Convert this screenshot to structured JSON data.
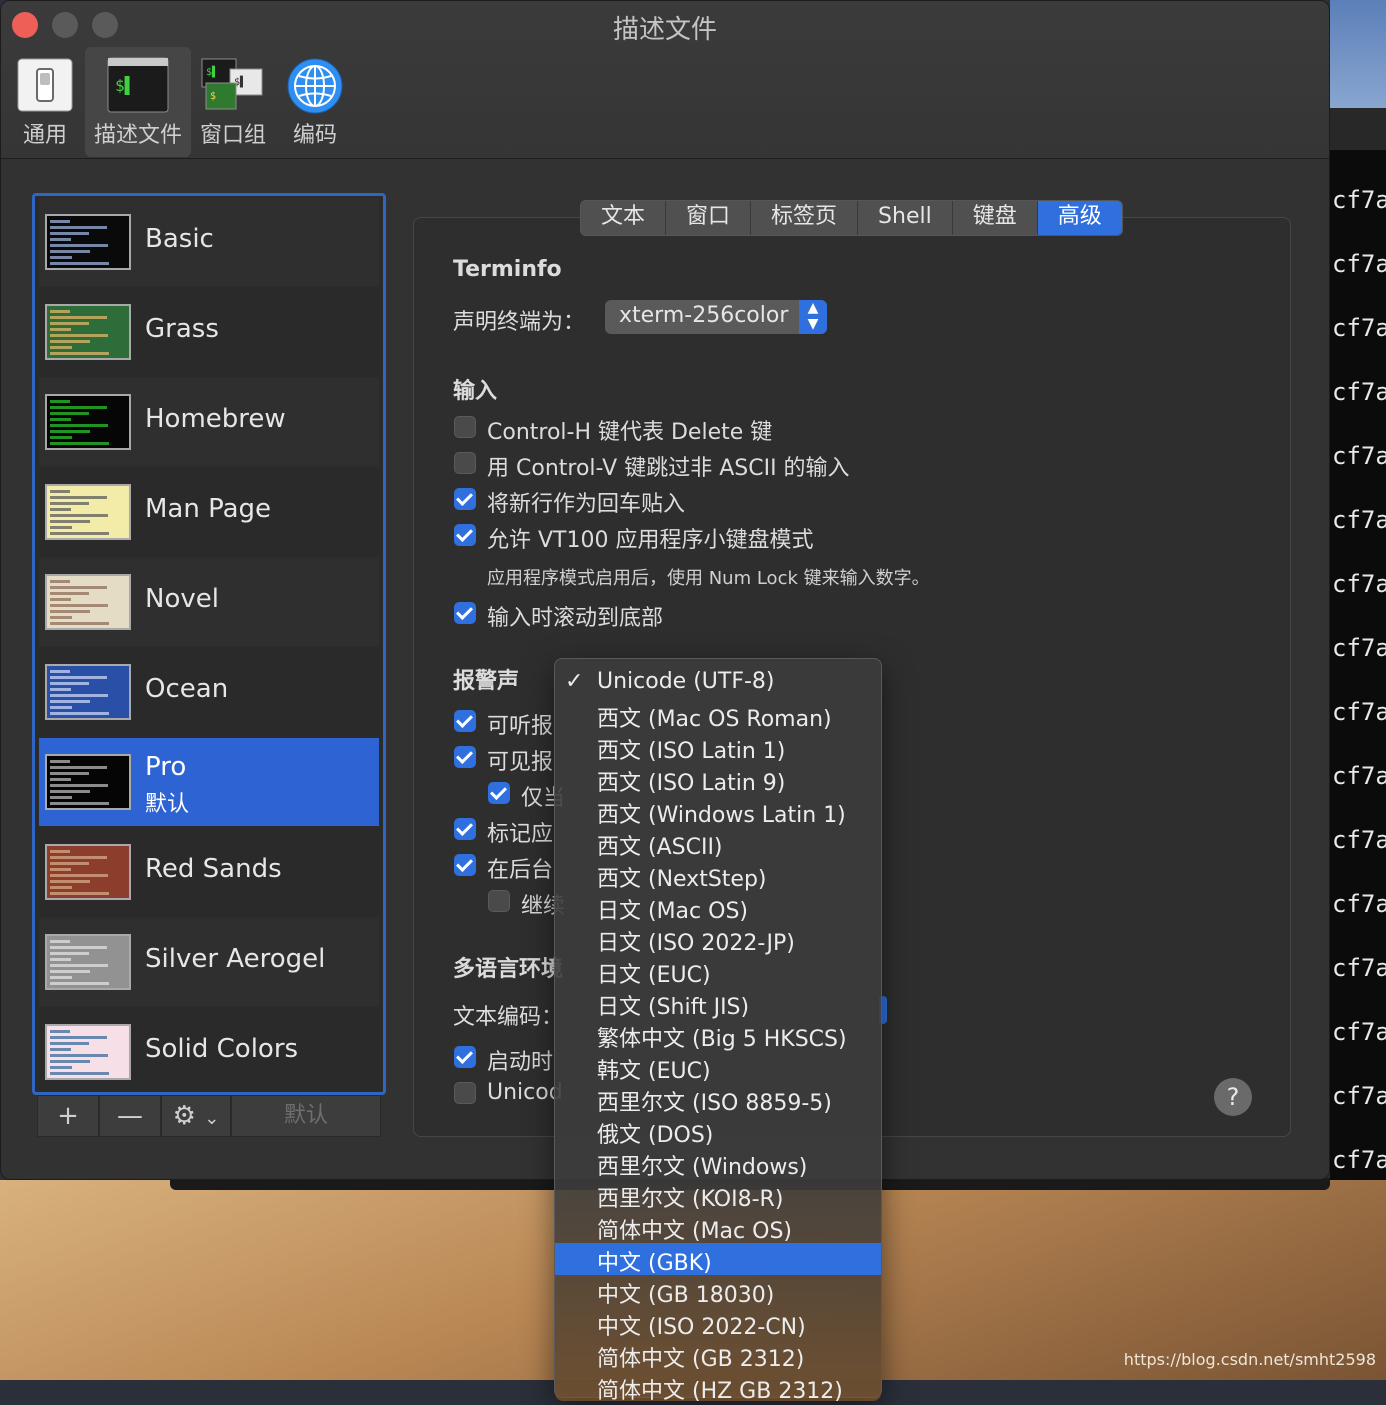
{
  "window": {
    "title": "描述文件"
  },
  "toolbar": {
    "items": [
      {
        "label": "通用",
        "icon": "general-switch-icon"
      },
      {
        "label": "描述文件",
        "icon": "terminal-profile-icon"
      },
      {
        "label": "窗口组",
        "icon": "window-groups-icon"
      },
      {
        "label": "编码",
        "icon": "globe-icon"
      }
    ]
  },
  "profiles": [
    {
      "name": "Basic",
      "thumb_bg": "#0a0a0a",
      "thumb_fg": "#9bb0d8"
    },
    {
      "name": "Grass",
      "thumb_bg": "#2e6d3a",
      "thumb_fg": "#e2b46a"
    },
    {
      "name": "Homebrew",
      "thumb_bg": "#060606",
      "thumb_fg": "#29c329"
    },
    {
      "name": "Man Page",
      "thumb_bg": "#f3eca8",
      "thumb_fg": "#5b5b5b"
    },
    {
      "name": "Novel",
      "thumb_bg": "#e5dcc5",
      "thumb_fg": "#8e6f58"
    },
    {
      "name": "Ocean",
      "thumb_bg": "#2a4fa6",
      "thumb_fg": "#c9d6f4"
    },
    {
      "name": "Pro",
      "sub": "默认",
      "thumb_bg": "#050505",
      "thumb_fg": "#b8b8b8"
    },
    {
      "name": "Red Sands",
      "thumb_bg": "#8d3d2c",
      "thumb_fg": "#d5a886"
    },
    {
      "name": "Silver Aerogel",
      "thumb_bg": "#929292",
      "thumb_fg": "#e0e0e0"
    },
    {
      "name": "Solid Colors",
      "thumb_bg": "#f6dfe6",
      "thumb_fg": "#3a6b9c"
    }
  ],
  "list_controls": {
    "add": "+",
    "remove": "—",
    "gear": "⚙",
    "chevron": "⌄",
    "default": "默认"
  },
  "tabs": [
    "文本",
    "窗口",
    "标签页",
    "Shell",
    "键盘",
    "高级"
  ],
  "terminfo": {
    "heading": "Terminfo",
    "declare_label": "声明终端为：",
    "declare_value": "xterm-256color"
  },
  "input": {
    "heading": "输入",
    "options": [
      {
        "label": "Control-H 键代表 Delete 键",
        "checked": false
      },
      {
        "label": "用 Control-V 键跳过非 ASCII 的输入",
        "checked": false
      },
      {
        "label": "将新行作为回车贴入",
        "checked": true
      },
      {
        "label": "允许 VT100 应用程序小键盘模式",
        "checked": true
      }
    ],
    "hint": "应用程序模式启用后，使用 Num Lock 键来输入数字。",
    "scroll_option": {
      "label": "输入时滚动到底部",
      "checked": true
    }
  },
  "bell": {
    "heading": "报警声",
    "options": [
      {
        "label": "可听报",
        "checked": true
      },
      {
        "label": "可见报",
        "checked": true
      },
      {
        "label": "仅当",
        "checked": true
      },
      {
        "label": "标记应",
        "checked": true
      },
      {
        "label": "在后台",
        "checked": true
      },
      {
        "label": "继续",
        "checked": false
      }
    ]
  },
  "intl": {
    "heading": "多语言环境",
    "encoding_label": "文本编码：",
    "options": [
      {
        "label": "启动时",
        "checked": true
      },
      {
        "label": "Unicod",
        "checked": false
      }
    ]
  },
  "help": "?",
  "encoding_menu": {
    "items": [
      {
        "label": "Unicode (UTF-8)",
        "checked": true
      },
      {
        "label": "西文 (Mac OS Roman)"
      },
      {
        "label": "西文 (ISO Latin 1)"
      },
      {
        "label": "西文 (ISO Latin 9)"
      },
      {
        "label": "西文 (Windows Latin 1)"
      },
      {
        "label": "西文 (ASCII)"
      },
      {
        "label": "西文 (NextStep)"
      },
      {
        "label": "日文 (Mac OS)"
      },
      {
        "label": "日文 (ISO 2022-JP)"
      },
      {
        "label": "日文 (EUC)"
      },
      {
        "label": "日文 (Shift JIS)"
      },
      {
        "label": "繁体中文 (Big 5 HKSCS)"
      },
      {
        "label": "韩文 (EUC)"
      },
      {
        "label": "西里尔文 (ISO 8859-5)"
      },
      {
        "label": "俄文 (DOS)"
      },
      {
        "label": "西里尔文 (Windows)"
      },
      {
        "label": "西里尔文 (KOI8-R)"
      },
      {
        "label": "简体中文 (Mac OS)"
      },
      {
        "label": "中文 (GBK)",
        "highlighted": true
      },
      {
        "label": "中文 (GB 18030)"
      },
      {
        "label": "中文 (ISO 2022-CN)"
      },
      {
        "label": "简体中文 (GB 2312)"
      },
      {
        "label": "简体中文 (HZ GB 2312)"
      }
    ],
    "check_glyph": "✓"
  },
  "background_terminal": {
    "line_text": "cf7a"
  },
  "watermark": "https://blog.csdn.net/smht2598",
  "colors": {
    "accent": "#2f6fde",
    "close": "#ed5f57"
  }
}
